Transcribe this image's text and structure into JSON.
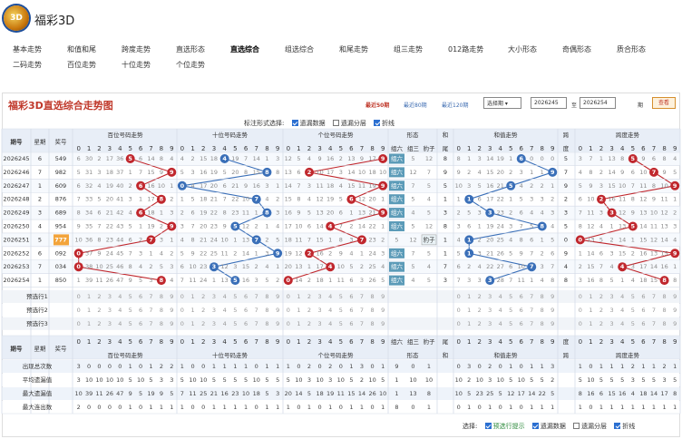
{
  "app": {
    "title": "福彩3D",
    "logo_text": "3D"
  },
  "nav": {
    "items": [
      "基本走势",
      "和值和尾",
      "跨度走势",
      "直选形态",
      "直选综合",
      "组选综合",
      "和尾走势",
      "组三走势",
      "012路走势",
      "大小形态",
      "奇偶形态",
      "质合形态",
      "二码走势",
      "百位走势",
      "十位走势",
      "个位走势"
    ],
    "active": "直选综合"
  },
  "panel": {
    "title": "福彩3D直选综合走势图",
    "periods": [
      "最近50期",
      "最近80期",
      "最近120期"
    ],
    "select_label": "选择期",
    "from": "2026245",
    "to_label": "至",
    "to": "2026254",
    "unit": "期",
    "query": "查看",
    "options_label": "标注形式选择:",
    "options": [
      {
        "label": "遗漏数据",
        "on": true
      },
      {
        "label": "遗漏分层",
        "on": false
      },
      {
        "label": "折线",
        "on": true
      }
    ]
  },
  "table": {
    "headers": {
      "period": "期号",
      "week": "星期",
      "prize": "奖号",
      "bai": "百位号码走势",
      "shi": "十位号码走势",
      "ge": "个位号码走势",
      "form": "形态",
      "form_cols": [
        "组六",
        "组三",
        "豹子"
      ],
      "hewei": "和尾",
      "hezhi": "和值走势",
      "kuadu": "跨度",
      "kuadu_trend": "跨度走势"
    },
    "hezhi_cols": [
      "0",
      "1",
      "2",
      "3",
      "4",
      "5",
      "6",
      "7",
      "8",
      "9"
    ],
    "rows": [
      {
        "period": "2026245",
        "week": "6",
        "prize": "549",
        "b": [
          6,
          30,
          2,
          17,
          36,
          5,
          6,
          14,
          8,
          4
        ],
        "s": [
          4,
          2,
          15,
          18,
          4,
          19,
          7,
          14,
          1,
          3
        ],
        "g": [
          12,
          5,
          4,
          9,
          16,
          2,
          13,
          9,
          17,
          9
        ],
        "form": "组六",
        "hw": "8",
        "hz": [
          8,
          1,
          3,
          14,
          19,
          1,
          2,
          0,
          0,
          0
        ],
        "hzd": 6,
        "kd": "5",
        "kw": [
          3,
          7,
          1,
          13,
          8,
          5,
          9,
          6,
          8,
          4
        ],
        "kp": 5,
        "hl": false
      },
      {
        "period": "2026246",
        "week": "7",
        "prize": "982",
        "b": [
          5,
          31,
          3,
          18,
          37,
          1,
          7,
          15,
          9,
          9
        ],
        "s": [
          5,
          3,
          16,
          19,
          5,
          20,
          8,
          15,
          2,
          8
        ],
        "g": [
          13,
          6,
          2,
          10,
          17,
          3,
          14,
          10,
          18,
          10
        ],
        "form": "组六",
        "hw": "9",
        "hz": [
          9,
          2,
          4,
          15,
          20,
          2,
          3,
          1,
          1,
          9
        ],
        "hzd": 9,
        "kd": "7",
        "kw": [
          4,
          8,
          2,
          14,
          9,
          6,
          10,
          7,
          9,
          5
        ],
        "kp": 7,
        "hl": false
      },
      {
        "period": "2026247",
        "week": "1",
        "prize": "609",
        "b": [
          6,
          32,
          4,
          19,
          40,
          2,
          6,
          16,
          10,
          1
        ],
        "s": [
          0,
          4,
          17,
          20,
          6,
          21,
          9,
          16,
          3,
          1
        ],
        "g": [
          14,
          7,
          3,
          11,
          18,
          4,
          15,
          11,
          19,
          9
        ],
        "form": "组六",
        "hw": "5",
        "hz": [
          10,
          3,
          5,
          16,
          21,
          5,
          4,
          2,
          2,
          1
        ],
        "hzd": 5,
        "kd": "9",
        "kw": [
          5,
          9,
          3,
          15,
          10,
          7,
          11,
          8,
          10,
          9
        ],
        "kp": 9,
        "hl": false
      },
      {
        "period": "2026248",
        "week": "2",
        "prize": "876",
        "b": [
          7,
          33,
          5,
          20,
          41,
          3,
          1,
          17,
          8,
          2
        ],
        "s": [
          1,
          5,
          18,
          21,
          7,
          22,
          10,
          7,
          4,
          2
        ],
        "g": [
          15,
          8,
          4,
          12,
          19,
          5,
          6,
          12,
          20,
          1
        ],
        "form": "组六",
        "hw": "1",
        "hz": [
          1,
          4,
          6,
          17,
          22,
          1,
          5,
          3,
          3,
          2
        ],
        "hzd": 1,
        "kd": "2",
        "kw": [
          6,
          10,
          2,
          16,
          11,
          8,
          12,
          9,
          11,
          1
        ],
        "kp": 2,
        "hl": false
      },
      {
        "period": "2026249",
        "week": "3",
        "prize": "689",
        "b": [
          8,
          34,
          6,
          21,
          42,
          4,
          6,
          18,
          1,
          3
        ],
        "s": [
          2,
          6,
          19,
          22,
          8,
          23,
          11,
          1,
          8,
          3
        ],
        "g": [
          16,
          9,
          5,
          13,
          20,
          6,
          1,
          13,
          21,
          9
        ],
        "form": "组六",
        "hw": "3",
        "hz": [
          2,
          5,
          3,
          18,
          23,
          2,
          6,
          4,
          4,
          3
        ],
        "hzd": 3,
        "kd": "3",
        "kw": [
          7,
          11,
          3,
          3,
          12,
          9,
          13,
          10,
          12,
          2
        ],
        "kp": 3,
        "hl": false
      },
      {
        "period": "2026250",
        "week": "4",
        "prize": "954",
        "b": [
          9,
          35,
          7,
          22,
          43,
          5,
          1,
          19,
          2,
          9
        ],
        "s": [
          3,
          7,
          20,
          23,
          9,
          5,
          12,
          2,
          1,
          4
        ],
        "g": [
          17,
          10,
          6,
          14,
          4,
          7,
          2,
          14,
          22,
          1
        ],
        "form": "组六",
        "hw": "8",
        "hz": [
          3,
          6,
          1,
          19,
          24,
          3,
          7,
          5,
          8,
          4
        ],
        "hzd": 8,
        "kd": "5",
        "kw": [
          8,
          12,
          4,
          1,
          13,
          5,
          14,
          11,
          13,
          3
        ],
        "kp": 5,
        "hl": false
      },
      {
        "period": "2026251",
        "week": "5",
        "prize": "777",
        "b": [
          10,
          36,
          8,
          23,
          44,
          6,
          2,
          7,
          3,
          1
        ],
        "s": [
          4,
          8,
          21,
          24,
          10,
          1,
          13,
          7,
          2,
          5
        ],
        "g": [
          18,
          11,
          7,
          15,
          1,
          8,
          3,
          7,
          23,
          2
        ],
        "form": "豹子",
        "hw": "1",
        "hz": [
          4,
          1,
          2,
          20,
          25,
          4,
          8,
          6,
          1,
          5
        ],
        "hzd": 1,
        "kd": "0",
        "kw": [
          0,
          13,
          5,
          2,
          14,
          1,
          15,
          12,
          14,
          4
        ],
        "kp": 0,
        "hl": true
      },
      {
        "period": "2026252",
        "week": "6",
        "prize": "092",
        "b": [
          0,
          37,
          9,
          24,
          45,
          7,
          3,
          1,
          4,
          2
        ],
        "s": [
          5,
          9,
          22,
          25,
          11,
          2,
          14,
          1,
          3,
          9
        ],
        "g": [
          19,
          12,
          2,
          16,
          2,
          9,
          4,
          1,
          24,
          3
        ],
        "form": "组六",
        "hw": "1",
        "hz": [
          5,
          1,
          3,
          21,
          26,
          5,
          9,
          7,
          2,
          6
        ],
        "hzd": 1,
        "kd": "9",
        "kw": [
          1,
          14,
          6,
          3,
          15,
          2,
          16,
          13,
          15,
          9
        ],
        "kp": 9,
        "hl": false
      },
      {
        "period": "2026253",
        "week": "7",
        "prize": "034",
        "b": [
          0,
          38,
          10,
          25,
          46,
          8,
          4,
          2,
          5,
          3
        ],
        "s": [
          6,
          10,
          23,
          3,
          12,
          3,
          15,
          2,
          4,
          1
        ],
        "g": [
          20,
          13,
          1,
          17,
          4,
          10,
          5,
          2,
          25,
          4
        ],
        "form": "组六",
        "hw": "7",
        "hz": [
          6,
          2,
          4,
          22,
          27,
          6,
          10,
          7,
          3,
          7
        ],
        "hzd": 7,
        "kd": "4",
        "kw": [
          2,
          15,
          7,
          4,
          4,
          3,
          17,
          14,
          16,
          1
        ],
        "kp": 4,
        "hl": false
      },
      {
        "period": "2026254",
        "week": "1",
        "prize": "850",
        "b": [
          1,
          39,
          11,
          26,
          47,
          9,
          5,
          3,
          8,
          4
        ],
        "s": [
          7,
          11,
          24,
          1,
          13,
          5,
          16,
          3,
          5,
          2
        ],
        "g": [
          0,
          14,
          2,
          18,
          1,
          11,
          6,
          3,
          26,
          5
        ],
        "form": "组六",
        "hw": "3",
        "hz": [
          7,
          3,
          3,
          23,
          28,
          7,
          11,
          1,
          4,
          8
        ],
        "hzd": 3,
        "kd": "8",
        "kw": [
          3,
          16,
          8,
          5,
          1,
          4,
          18,
          15,
          17,
          8
        ],
        "kp": 8,
        "hl": false
      }
    ],
    "pre_rows": [
      "预选行1",
      "预选行2",
      "预选行3"
    ],
    "digits": [
      "0",
      "1",
      "2",
      "3",
      "4",
      "5",
      "6",
      "7",
      "8",
      "9"
    ],
    "stats": [
      {
        "label": "出现总次数",
        "b": [
          3,
          0,
          0,
          0,
          0,
          1,
          0,
          1,
          2,
          2,
          2
        ],
        "s": [
          1,
          0,
          0,
          1,
          1,
          1,
          1,
          0,
          1,
          1
        ],
        "g": [
          1,
          0,
          2,
          0,
          2,
          0,
          1,
          3,
          0,
          1
        ],
        "f": [
          "9",
          "0",
          "1"
        ],
        "hw": "",
        "hz": [
          0,
          3,
          0,
          2,
          0,
          1,
          0,
          1,
          1,
          3
        ],
        "kd": "",
        "kw": [
          1,
          0,
          1,
          1,
          1,
          2,
          1,
          1,
          2,
          1
        ]
      },
      {
        "label": "平均遗漏值",
        "b": [
          3,
          10,
          10,
          10,
          10,
          5,
          10,
          5,
          3,
          3
        ],
        "s": [
          5,
          10,
          10,
          5,
          5,
          5,
          5,
          10,
          5,
          5
        ],
        "g": [
          5,
          10,
          3,
          10,
          3,
          10,
          5,
          2,
          10,
          5
        ],
        "f": [
          "1",
          "10",
          "10"
        ],
        "hw": "",
        "hz": [
          10,
          2,
          10,
          3,
          10,
          5,
          10,
          5,
          5,
          2
        ],
        "kd": "",
        "kw": [
          5,
          10,
          5,
          5,
          5,
          3,
          5,
          5,
          3,
          5
        ]
      },
      {
        "label": "最大遗漏值",
        "b": [
          10,
          39,
          11,
          26,
          47,
          9,
          5,
          19,
          9,
          5
        ],
        "s": [
          7,
          11,
          25,
          21,
          16,
          23,
          10,
          18,
          5,
          3
        ],
        "g": [
          20,
          14,
          5,
          18,
          19,
          11,
          15,
          14,
          26,
          10
        ],
        "f": [
          "1",
          "13",
          "8"
        ],
        "hw": "",
        "hz": [
          10,
          5,
          23,
          25,
          5,
          12,
          17,
          14,
          22,
          5
        ],
        "kd": "",
        "kw": [
          8,
          16,
          6,
          15,
          16,
          4,
          18,
          14,
          17,
          8
        ]
      },
      {
        "label": "最大连出数",
        "b": [
          2,
          0,
          0,
          0,
          0,
          1,
          0,
          1,
          1,
          1
        ],
        "s": [
          1,
          0,
          0,
          1,
          1,
          1,
          1,
          0,
          1,
          1
        ],
        "g": [
          1,
          0,
          1,
          0,
          1,
          0,
          1,
          1,
          0,
          1
        ],
        "f": [
          "8",
          "0",
          "1"
        ],
        "hw": "",
        "hz": [
          0,
          1,
          0,
          1,
          0,
          1,
          0,
          1,
          1,
          1
        ],
        "kd": "",
        "kw": [
          1,
          0,
          1,
          1,
          1,
          1,
          1,
          1,
          1,
          1
        ]
      }
    ],
    "footer": {
      "label": "选择:",
      "items": [
        {
          "label": "预选行提示",
          "on": true,
          "accent": true
        },
        {
          "label": "遗漏数据",
          "on": true
        },
        {
          "label": "遗漏分层",
          "on": false
        },
        {
          "label": "折线",
          "on": true
        }
      ]
    },
    "colors": {
      "red": "#c0272d",
      "blue": "#3a6fb8",
      "grid": "#d6dce8",
      "header": "#e8eef7",
      "odd": "#f6f9fd",
      "highlight": "#f3a43b",
      "form": "#5b9bb8"
    }
  }
}
